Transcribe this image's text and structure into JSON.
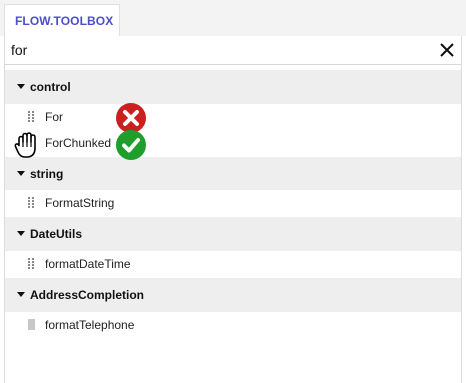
{
  "tab": {
    "label": "FLOW.TOOLBOX"
  },
  "search": {
    "value": "for",
    "placeholder": ""
  },
  "categories": [
    {
      "label": "control",
      "items": [
        {
          "label": "For",
          "status": "wrong"
        },
        {
          "label": "ForChunked",
          "status": "correct"
        }
      ]
    },
    {
      "label": "string",
      "items": [
        {
          "label": "FormatString"
        }
      ]
    },
    {
      "label": "DateUtils",
      "items": [
        {
          "label": "formatDateTime"
        }
      ]
    },
    {
      "label": "AddressCompletion",
      "items": [
        {
          "label": "formatTelephone"
        }
      ]
    }
  ],
  "icons": {
    "clear": "close-icon",
    "expand": "caret-down-icon",
    "drag": "drag-grip-icon",
    "wrong": "red-x-circle-icon",
    "correct": "green-check-circle-icon",
    "cursor": "grab-hand-cursor-icon"
  },
  "colors": {
    "tab_text": "#4b4ec9",
    "category_bg": "#eeeeee",
    "wrong": "#cc1f1f",
    "correct": "#1f9e2c"
  }
}
